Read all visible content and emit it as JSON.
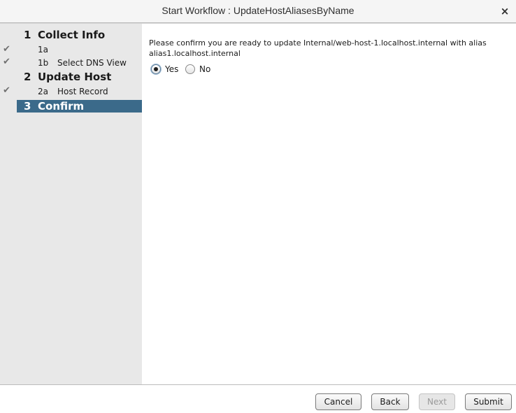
{
  "window": {
    "title": "Start Workflow : UpdateHostAliasesByName",
    "close_icon": "×"
  },
  "sidebar": {
    "steps": [
      {
        "type": "major",
        "number": "1",
        "label": "Collect Info",
        "checked": false,
        "active": false
      },
      {
        "type": "minor",
        "number": "1a",
        "label": "",
        "checked": true,
        "active": false
      },
      {
        "type": "minor",
        "number": "1b",
        "label": "Select DNS View",
        "checked": true,
        "active": false
      },
      {
        "type": "major",
        "number": "2",
        "label": "Update Host",
        "checked": false,
        "active": false
      },
      {
        "type": "minor",
        "number": "2a",
        "label": "Host Record",
        "checked": true,
        "active": false
      },
      {
        "type": "major",
        "number": "3",
        "label": "Confirm",
        "checked": false,
        "active": true
      }
    ],
    "check_icon": "✔"
  },
  "content": {
    "message": "Please confirm you are ready to update Internal/web-host-1.localhost.internal with alias alias1.localhost.internal",
    "options": [
      {
        "label": "Yes",
        "selected": true
      },
      {
        "label": "No",
        "selected": false
      }
    ]
  },
  "footer": {
    "cancel_label": "Cancel",
    "back_label": "Back",
    "next_label": "Next",
    "submit_label": "Submit",
    "next_enabled": false
  },
  "colors": {
    "active_step_bg": "#3b6a8a",
    "sidebar_bg": "#e8e8e8"
  }
}
